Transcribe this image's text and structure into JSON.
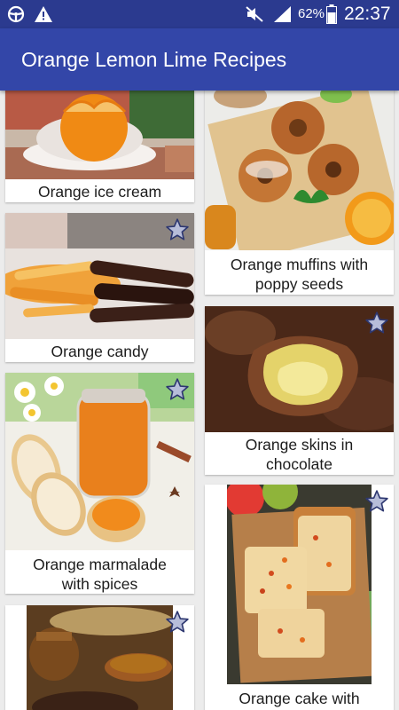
{
  "status": {
    "battery_text": "62%",
    "time": "22:37",
    "icons": [
      "steering-wheel-icon",
      "warning-icon",
      "mute-icon",
      "signal-icon",
      "battery-icon"
    ]
  },
  "app": {
    "title": "Orange Lemon Lime Recipes"
  },
  "colors": {
    "statusbar": "#2b3a8f",
    "appbar": "#3346a8",
    "background": "#ececec",
    "star_fill": "#b7bdd9"
  },
  "recipes": [
    {
      "caption": "Orange ice cream"
    },
    {
      "caption": "Orange candy"
    },
    {
      "caption": "Orange marmalade\nwith spices"
    },
    {
      "caption": ""
    },
    {
      "caption": "Orange muffins with\npoppy seeds"
    },
    {
      "caption": "Orange skins in\nchocolate"
    },
    {
      "caption": "Orange cake with"
    }
  ]
}
